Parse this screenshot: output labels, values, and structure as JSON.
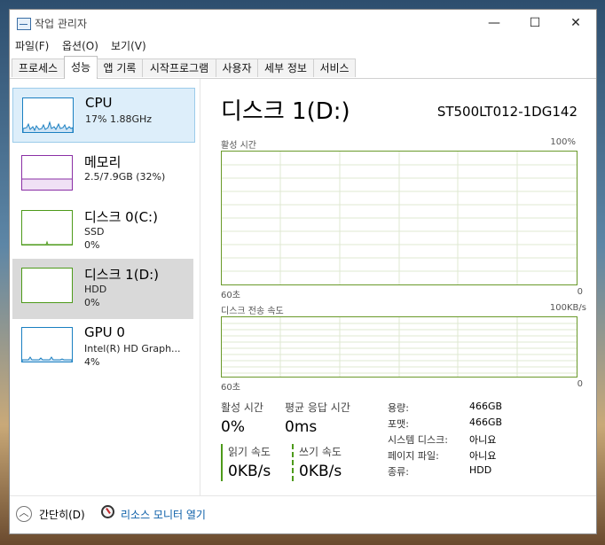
{
  "window": {
    "title": "작업 관리자",
    "controls": {
      "minimize": "—",
      "maximize": "☐",
      "close": "✕"
    }
  },
  "menu": [
    "파일(F)",
    "옵션(O)",
    "보기(V)"
  ],
  "tabs": [
    "프로세스",
    "성능",
    "앱 기록",
    "시작프로그램",
    "사용자",
    "세부 정보",
    "서비스"
  ],
  "active_tab": "성능",
  "resources": [
    {
      "name": "CPU",
      "line1": "17% 1.88GHz",
      "line2": "",
      "color": "#1a7fc1",
      "selected": "blue"
    },
    {
      "name": "메모리",
      "line1": "2.5/7.9GB (32%)",
      "line2": "",
      "color": "#8a2fa5",
      "selected": "none"
    },
    {
      "name": "디스크 0(C:)",
      "line1": "SSD",
      "line2": "0%",
      "color": "#4d9a1a",
      "selected": "none"
    },
    {
      "name": "디스크 1(D:)",
      "line1": "HDD",
      "line2": "0%",
      "color": "#4d9a1a",
      "selected": "gray"
    },
    {
      "name": "GPU 0",
      "line1": "Intel(R) HD Graph...",
      "line2": "4%",
      "color": "#1a7fc1",
      "selected": "none"
    }
  ],
  "main": {
    "title": "디스크 1(D:)",
    "model": "ST500LT012-1DG142",
    "graph1": {
      "label": "활성 시간",
      "max": "100%",
      "time": "60초",
      "min": "0"
    },
    "graph2": {
      "label": "디스크 전송 속도",
      "max": "100KB/s",
      "time": "60초",
      "min": "0"
    },
    "stats": {
      "active_time_label": "활성 시간",
      "active_time_value": "0%",
      "avg_response_label": "평균 응답 시간",
      "avg_response_value": "0ms",
      "read_label": "읽기 속도",
      "read_value": "0KB/s",
      "write_label": "쓰기 속도",
      "write_value": "0KB/s"
    },
    "info": [
      {
        "k": "용량:",
        "v": "466GB"
      },
      {
        "k": "포맷:",
        "v": "466GB"
      },
      {
        "k": "시스템 디스크:",
        "v": "아니요"
      },
      {
        "k": "페이지 파일:",
        "v": "아니요"
      },
      {
        "k": "종류:",
        "v": "HDD"
      }
    ]
  },
  "footer": {
    "collapse_icon": "︿",
    "collapse_label": "간단히(D)",
    "monitor_label": "리소스 모니터 열기"
  }
}
